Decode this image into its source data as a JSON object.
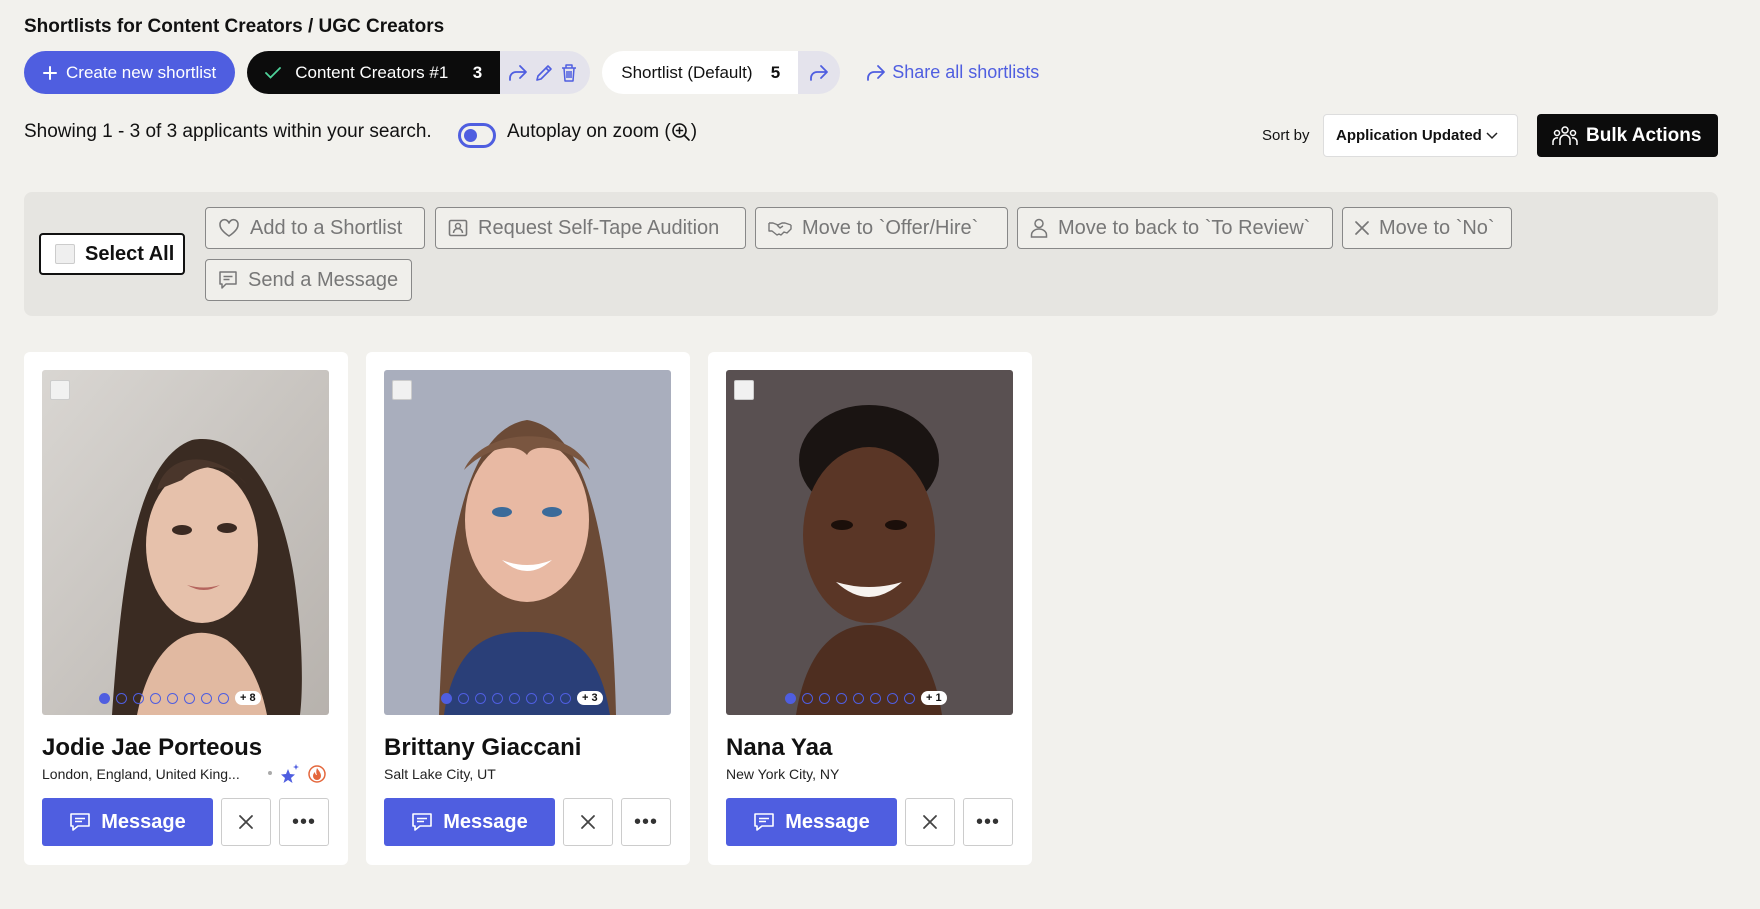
{
  "page": {
    "title": "Shortlists for Content Creators / UGC Creators"
  },
  "toolbar": {
    "create_label": "Create new shortlist",
    "active_shortlist": {
      "name": "Content Creators #1",
      "count": "3"
    },
    "default_shortlist": {
      "name": "Shortlist (Default)",
      "count": "5"
    },
    "share_all_label": "Share all shortlists"
  },
  "results": {
    "showing_text": "Showing 1 - 3 of 3 applicants within your search.",
    "autoplay_label": "Autoplay on zoom (",
    "autoplay_suffix": ")"
  },
  "sort": {
    "label": "Sort by",
    "value": "Application Updated"
  },
  "bulk_actions_label": "Bulk Actions",
  "actions": {
    "select_all": "Select All",
    "add_shortlist": "Add to a Shortlist",
    "request_audition": "Request Self-Tape Audition",
    "move_offer": "Move to `Offer/Hire`",
    "move_review": "Move to back to `To Review`",
    "move_no": "Move to `No`",
    "send_message": "Send a Message"
  },
  "colors": {
    "accent": "#4f5ee0",
    "dark": "#0c0c0c",
    "background": "#f2f1ed"
  },
  "applicants": [
    {
      "name": "Jodie Jae Porteous",
      "location": "London, England, United King...",
      "extra_photos": "+ 8",
      "message_label": "Message",
      "has_badges": true
    },
    {
      "name": "Brittany Giaccani",
      "location": "Salt Lake City, UT",
      "extra_photos": "+ 3",
      "message_label": "Message",
      "has_badges": false
    },
    {
      "name": "Nana Yaa",
      "location": "New York City, NY",
      "extra_photos": "+ 1",
      "message_label": "Message",
      "has_badges": false
    }
  ]
}
